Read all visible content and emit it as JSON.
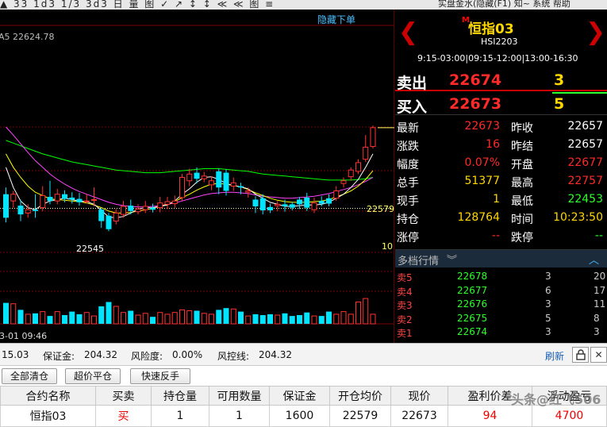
{
  "topbar": {
    "tools": "▲ 33 1d3 1/3 3d3 日 量 图 ✓ ↗ ↕ ↕ ≪ ≪ 图 ≡",
    "right": "实盘金水(隐藏(F1)  知~  系统  帮助"
  },
  "chart": {
    "hide_order_link": "隐藏下单",
    "ma_label": "A5 22624.78",
    "price_marker": "22579",
    "low_label": "22545",
    "axis_right_label": "10",
    "time_label": "3-01 09:46",
    "colors": {
      "up": "#ff3333",
      "down": "#00e5ff",
      "ma5": "#ffffff",
      "ma10": "#ffff00",
      "ma20": "#ff44ff",
      "ma60": "#00ff00"
    },
    "candles": [
      {
        "o": 22600,
        "c": 22565,
        "h": 22610,
        "l": 22558
      },
      {
        "o": 22590,
        "c": 22600,
        "h": 22605,
        "l": 22580
      },
      {
        "o": 22583,
        "c": 22570,
        "h": 22592,
        "l": 22560
      },
      {
        "o": 22572,
        "c": 22577,
        "h": 22585,
        "l": 22565
      },
      {
        "o": 22577,
        "c": 22575,
        "h": 22600,
        "l": 22565
      },
      {
        "o": 22580,
        "c": 22598,
        "h": 22612,
        "l": 22575
      },
      {
        "o": 22596,
        "c": 22590,
        "h": 22620,
        "l": 22585
      },
      {
        "o": 22590,
        "c": 22600,
        "h": 22608,
        "l": 22585
      },
      {
        "o": 22600,
        "c": 22593,
        "h": 22606,
        "l": 22588
      },
      {
        "o": 22595,
        "c": 22592,
        "h": 22603,
        "l": 22586
      },
      {
        "o": 22593,
        "c": 22588,
        "h": 22602,
        "l": 22583
      },
      {
        "o": 22590,
        "c": 22590,
        "h": 22600,
        "l": 22586
      },
      {
        "o": 22592,
        "c": 22592,
        "h": 22610,
        "l": 22582
      },
      {
        "o": 22577,
        "c": 22560,
        "h": 22580,
        "l": 22550
      },
      {
        "o": 22568,
        "c": 22548,
        "h": 22572,
        "l": 22545
      },
      {
        "o": 22560,
        "c": 22572,
        "h": 22578,
        "l": 22555
      },
      {
        "o": 22570,
        "c": 22582,
        "h": 22590,
        "l": 22565
      },
      {
        "o": 22583,
        "c": 22575,
        "h": 22592,
        "l": 22570
      },
      {
        "o": 22574,
        "c": 22578,
        "h": 22585,
        "l": 22570
      },
      {
        "o": 22577,
        "c": 22582,
        "h": 22590,
        "l": 22572
      },
      {
        "o": 22580,
        "c": 22577,
        "h": 22586,
        "l": 22573
      },
      {
        "o": 22580,
        "c": 22587,
        "h": 22596,
        "l": 22573
      },
      {
        "o": 22585,
        "c": 22589,
        "h": 22596,
        "l": 22578
      },
      {
        "o": 22586,
        "c": 22590,
        "h": 22598,
        "l": 22580
      },
      {
        "o": 22595,
        "c": 22625,
        "h": 22630,
        "l": 22590
      },
      {
        "o": 22620,
        "c": 22630,
        "h": 22638,
        "l": 22612
      },
      {
        "o": 22632,
        "c": 22623,
        "h": 22640,
        "l": 22616
      },
      {
        "o": 22623,
        "c": 22627,
        "h": 22633,
        "l": 22618
      },
      {
        "o": 22614,
        "c": 22620,
        "h": 22627,
        "l": 22606
      },
      {
        "o": 22634,
        "c": 22610,
        "h": 22638,
        "l": 22600
      },
      {
        "o": 22632,
        "c": 22605,
        "h": 22637,
        "l": 22598
      },
      {
        "o": 22612,
        "c": 22617,
        "h": 22625,
        "l": 22605
      },
      {
        "o": 22612,
        "c": 22610,
        "h": 22617,
        "l": 22600
      },
      {
        "o": 22603,
        "c": 22605,
        "h": 22610,
        "l": 22595
      },
      {
        "o": 22592,
        "c": 22582,
        "h": 22597,
        "l": 22572
      },
      {
        "o": 22594,
        "c": 22576,
        "h": 22600,
        "l": 22570
      },
      {
        "o": 22581,
        "c": 22576,
        "h": 22586,
        "l": 22572
      },
      {
        "o": 22583,
        "c": 22585,
        "h": 22590,
        "l": 22575
      },
      {
        "o": 22585,
        "c": 22582,
        "h": 22592,
        "l": 22574
      },
      {
        "o": 22585,
        "c": 22580,
        "h": 22589,
        "l": 22576
      },
      {
        "o": 22592,
        "c": 22585,
        "h": 22596,
        "l": 22578
      },
      {
        "o": 22595,
        "c": 22580,
        "h": 22602,
        "l": 22575
      },
      {
        "o": 22577,
        "c": 22587,
        "h": 22595,
        "l": 22572
      },
      {
        "o": 22590,
        "c": 22586,
        "h": 22597,
        "l": 22582
      },
      {
        "o": 22594,
        "c": 22586,
        "h": 22600,
        "l": 22582
      },
      {
        "o": 22594,
        "c": 22605,
        "h": 22612,
        "l": 22590
      },
      {
        "o": 22616,
        "c": 22620,
        "h": 22625,
        "l": 22610
      },
      {
        "o": 22626,
        "c": 22636,
        "h": 22640,
        "l": 22620
      },
      {
        "o": 22634,
        "c": 22647,
        "h": 22652,
        "l": 22630
      },
      {
        "o": 22652,
        "c": 22670,
        "h": 22688,
        "l": 22648
      },
      {
        "o": 22671,
        "c": 22699,
        "h": 22702,
        "l": 22668
      }
    ],
    "volumes": [
      24,
      23,
      16,
      11,
      12,
      14,
      9,
      14,
      10,
      14,
      11,
      13,
      9,
      20,
      25,
      20,
      13,
      15,
      10,
      12,
      8,
      13,
      11,
      13,
      16,
      15,
      15,
      12,
      11,
      16,
      18,
      17,
      14,
      9,
      11,
      10,
      11,
      10,
      12,
      9,
      10,
      13,
      9,
      9,
      14,
      11,
      14,
      11,
      25,
      29,
      11
    ],
    "ma5": [
      22640,
      22610,
      22590,
      22580,
      22577,
      22585,
      22590,
      22592,
      22594,
      22592,
      22590,
      22589,
      22585,
      22576,
      22566,
      22565,
      22567,
      22572,
      22578,
      22580,
      22580,
      22582,
      22584,
      22590,
      22600,
      22608,
      22618,
      22625,
      22626,
      22622,
      22616,
      22613,
      22611,
      22608,
      22600,
      22594,
      22588,
      22585,
      22582,
      22582,
      22583,
      22584,
      22584,
      22585,
      22588,
      22594,
      22600,
      22610,
      22622,
      22640,
      22660
    ],
    "ma10": [
      22660,
      22640,
      22625,
      22612,
      22603,
      22598,
      22593,
      22592,
      22591,
      22590,
      22589,
      22587,
      22584,
      22580,
      22575,
      22572,
      22572,
      22573,
      22575,
      22577,
      22579,
      22582,
      22585,
      22589,
      22595,
      22600,
      22606,
      22611,
      22615,
      22616,
      22615,
      22613,
      22611,
      22607,
      22602,
      22598,
      22594,
      22591,
      22589,
      22588,
      22588,
      22588,
      22589,
      22590,
      22592,
      22596,
      22600,
      22605,
      22612,
      22622,
      22635
    ],
    "ma20": [
      22700,
      22688,
      22675,
      22662,
      22650,
      22640,
      22630,
      22622,
      22615,
      22609,
      22604,
      22600,
      22596,
      22592,
      22588,
      22585,
      22583,
      22582,
      22581,
      22581,
      22582,
      22583,
      22585,
      22587,
      22590,
      22593,
      22596,
      22599,
      22601,
      22602,
      22603,
      22603,
      22602,
      22601,
      22599,
      22597,
      22596,
      22595,
      22594,
      22594,
      22595,
      22596,
      22597,
      22599,
      22601,
      22604,
      22607,
      22610,
      22614,
      22619,
      22625
    ],
    "ma60": [
      22680,
      22676,
      22672,
      22668,
      22664,
      22660,
      22657,
      22654,
      22651,
      22648,
      22646,
      22644,
      22642,
      22640,
      22638,
      22636,
      22635,
      22634,
      22633,
      22632,
      22632,
      22632,
      22633,
      22634,
      22635,
      22636,
      22637,
      22638,
      22638,
      22638,
      22637,
      22636,
      22635,
      22634,
      22632,
      22630,
      22629,
      22628,
      22627,
      22626,
      22625,
      22624,
      22623,
      22622,
      22621,
      22621,
      22621,
      22621,
      22622,
      22623,
      22625
    ]
  },
  "quote": {
    "title_prefix": "M",
    "title": "恒指03",
    "code": "HSI2203",
    "sessions": "9:15-03:00|09:15-12:00|13:00-16:30",
    "prev_icon": "chevron-left-icon",
    "next_icon": "chevron-right-icon",
    "sell_label": "卖出",
    "sell_price": "22674",
    "sell_vol": "3",
    "buy_label": "买入",
    "buy_price": "22673",
    "buy_vol": "5",
    "stats": [
      {
        "l1": "最新",
        "v1": "22673",
        "c1": "red",
        "l2": "昨收",
        "v2": "22657",
        "c2": "white"
      },
      {
        "l1": "涨跌",
        "v1": "16",
        "c1": "red",
        "l2": "昨结",
        "v2": "22657",
        "c2": "white"
      },
      {
        "l1": "幅度",
        "v1": "0.07%",
        "c1": "red",
        "l2": "开盘",
        "v2": "22677",
        "c2": "red"
      },
      {
        "l1": "总手",
        "v1": "51377",
        "c1": "yellow",
        "l2": "最高",
        "v2": "22757",
        "c2": "red"
      },
      {
        "l1": "现手",
        "v1": "1",
        "c1": "yellow",
        "l2": "最低",
        "v2": "22453",
        "c2": "green"
      },
      {
        "l1": "持仓",
        "v1": "128764",
        "c1": "yellow",
        "l2": "时间",
        "v2": "10:23:50",
        "c2": "yellow"
      },
      {
        "l1": "涨停",
        "v1": "--",
        "c1": "red",
        "l2": "跌停",
        "v2": "--",
        "c2": "green"
      }
    ],
    "depth_title": "多档行情",
    "depth": [
      {
        "label": "卖5",
        "price": "22678",
        "vol": "3",
        "total": "20"
      },
      {
        "label": "卖4",
        "price": "22677",
        "vol": "6",
        "total": "17"
      },
      {
        "label": "卖3",
        "price": "22676",
        "vol": "3",
        "total": "11"
      },
      {
        "label": "卖2",
        "price": "22675",
        "vol": "5",
        "total": "8"
      },
      {
        "label": "卖1",
        "price": "22674",
        "vol": "3",
        "total": "3"
      }
    ]
  },
  "status": {
    "balance": "15.03",
    "margin_label": "保证金:",
    "margin": "204.32",
    "risk_label": "风险度:",
    "risk": "0.00%",
    "control_label": "风控线:",
    "control": "204.32",
    "refresh": "刷新",
    "lock_icon": "lock-icon",
    "close_icon": "close-icon"
  },
  "actions": {
    "close_all": "全部清仓",
    "over_close": "超价平仓",
    "reverse": "快速反手"
  },
  "table": {
    "headers": [
      "合约名称",
      "买卖",
      "持仓量",
      "可用数量",
      "保证金",
      "开仓均价",
      "现价",
      "盈利价差",
      "浮动盈亏"
    ],
    "rows": [
      [
        "恒指03",
        "买",
        "1",
        "1",
        "1600",
        "22579",
        "22673",
        "94",
        "4700"
      ]
    ]
  },
  "watermark": "头条@红飞506"
}
